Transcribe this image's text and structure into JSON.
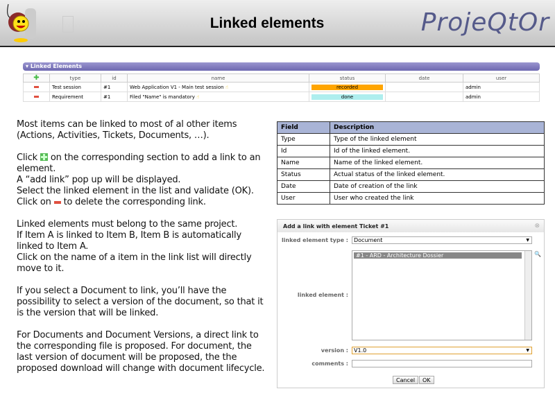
{
  "header": {
    "title": "Linked elements",
    "brand": "ProjeQtOr"
  },
  "panel": {
    "title": "Linked Elements",
    "columns": [
      "type",
      "id",
      "name",
      "status",
      "date",
      "user"
    ],
    "rows": [
      {
        "type": "Test session",
        "id": "#1",
        "name": "Web Application V1 - Main test session",
        "status": "recorded",
        "status_color": "#ffa500",
        "date": "",
        "user": "admin"
      },
      {
        "type": "Requirement",
        "id": "#1",
        "name": "Filed \"Name\" is mandatory",
        "status": "done",
        "status_color": "#aeeeee",
        "date": "",
        "user": "admin"
      }
    ]
  },
  "text": {
    "p1": "Most items can be linked to most of al other items (Actions, Activities, Tickets, Documents, …).",
    "p2a": "Click",
    "p2b": " on the corresponding section to add a link to an element.",
    "p2c": "A “add link” pop up will be displayed.",
    "p2d": "Select the linked element in the list and validate (OK).",
    "p2e": "Click on",
    "p2f": " to delete the corresponding link.",
    "p3a": "Linked elements must belong to the same project.",
    "p3b": "If Item A is linked to Item B, Item B is  automatically linked to Item A.",
    "p3c": "Click on the name of a item in the link list will directly move to it.",
    "p4": "If you select a Document to link, you’ll have the possibility to select a version of the document, so that it is the version that will be linked.",
    "p5": "For Documents and Document Versions, a direct link to the corresponding file is proposed. For document, the last version of document will be proposed, the the proposed download will change with document lifecycle."
  },
  "fields": {
    "headers": [
      "Field",
      "Description"
    ],
    "rows": [
      [
        "Type",
        "Type of the linked element"
      ],
      [
        "Id",
        "Id of the linked element."
      ],
      [
        "Name",
        "Name of the linked element."
      ],
      [
        "Status",
        "Actual status of the linked element."
      ],
      [
        "Date",
        "Date of creation of the link"
      ],
      [
        "User",
        "User who created the link"
      ]
    ]
  },
  "dialog": {
    "title": "Add a link with element Ticket #1",
    "type_label": "linked element type :",
    "type_value": "Document",
    "element_label": "linked element :",
    "element_selected": "#1 - ARD - Architecture Dossier",
    "version_label": "version :",
    "version_value": "V1.0",
    "comments_label": "comments :",
    "comments_value": "",
    "cancel": "Cancel",
    "ok": "OK"
  }
}
